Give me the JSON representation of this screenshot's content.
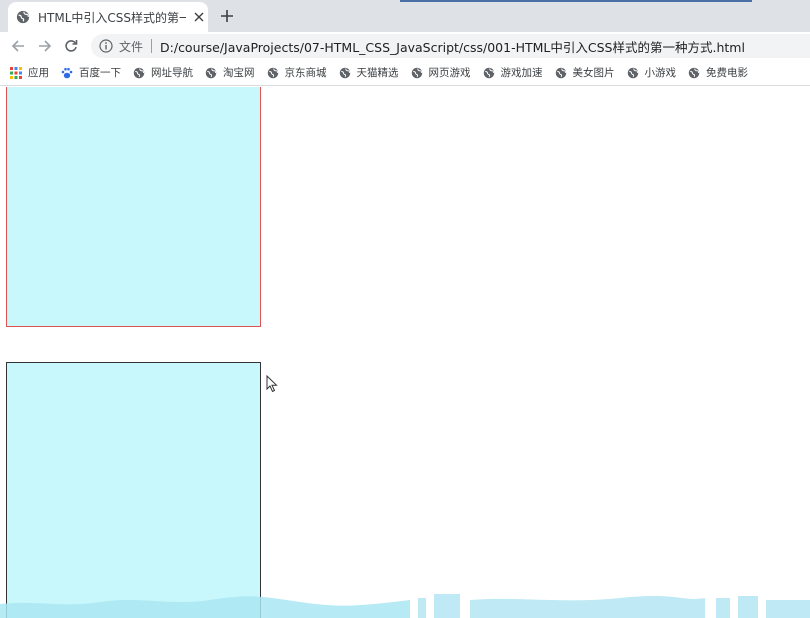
{
  "browser": {
    "tab": {
      "title": "HTML中引入CSS样式的第一种方",
      "close_icon": "close-icon",
      "favicon": "globe-icon"
    },
    "new_tab_icon": "plus-icon",
    "nav": {
      "back_icon": "arrow-left-icon",
      "forward_icon": "arrow-right-icon",
      "reload_icon": "reload-icon"
    },
    "omnibox": {
      "chip": "文件",
      "url": "D:/course/JavaProjects/07-HTML_CSS_JavaScript/css/001-HTML中引入CSS样式的第一种方式.html"
    },
    "bookmarks": [
      {
        "label": "应用",
        "icon": "apps-grid-icon"
      },
      {
        "label": "百度一下",
        "icon": "baidu-paw-icon"
      },
      {
        "label": "网址导航",
        "icon": "globe-icon"
      },
      {
        "label": "淘宝网",
        "icon": "globe-icon"
      },
      {
        "label": "京东商城",
        "icon": "globe-icon"
      },
      {
        "label": "天猫精选",
        "icon": "globe-icon"
      },
      {
        "label": "网页游戏",
        "icon": "globe-icon"
      },
      {
        "label": "游戏加速",
        "icon": "globe-icon"
      },
      {
        "label": "美女图片",
        "icon": "globe-icon"
      },
      {
        "label": "小游戏",
        "icon": "globe-icon"
      },
      {
        "label": "免费电影",
        "icon": "globe-icon"
      }
    ]
  },
  "page": {
    "box_fill_color": "#c8f7fc",
    "box1_border_color": "#e05353",
    "box2_border_color": "#333333"
  }
}
